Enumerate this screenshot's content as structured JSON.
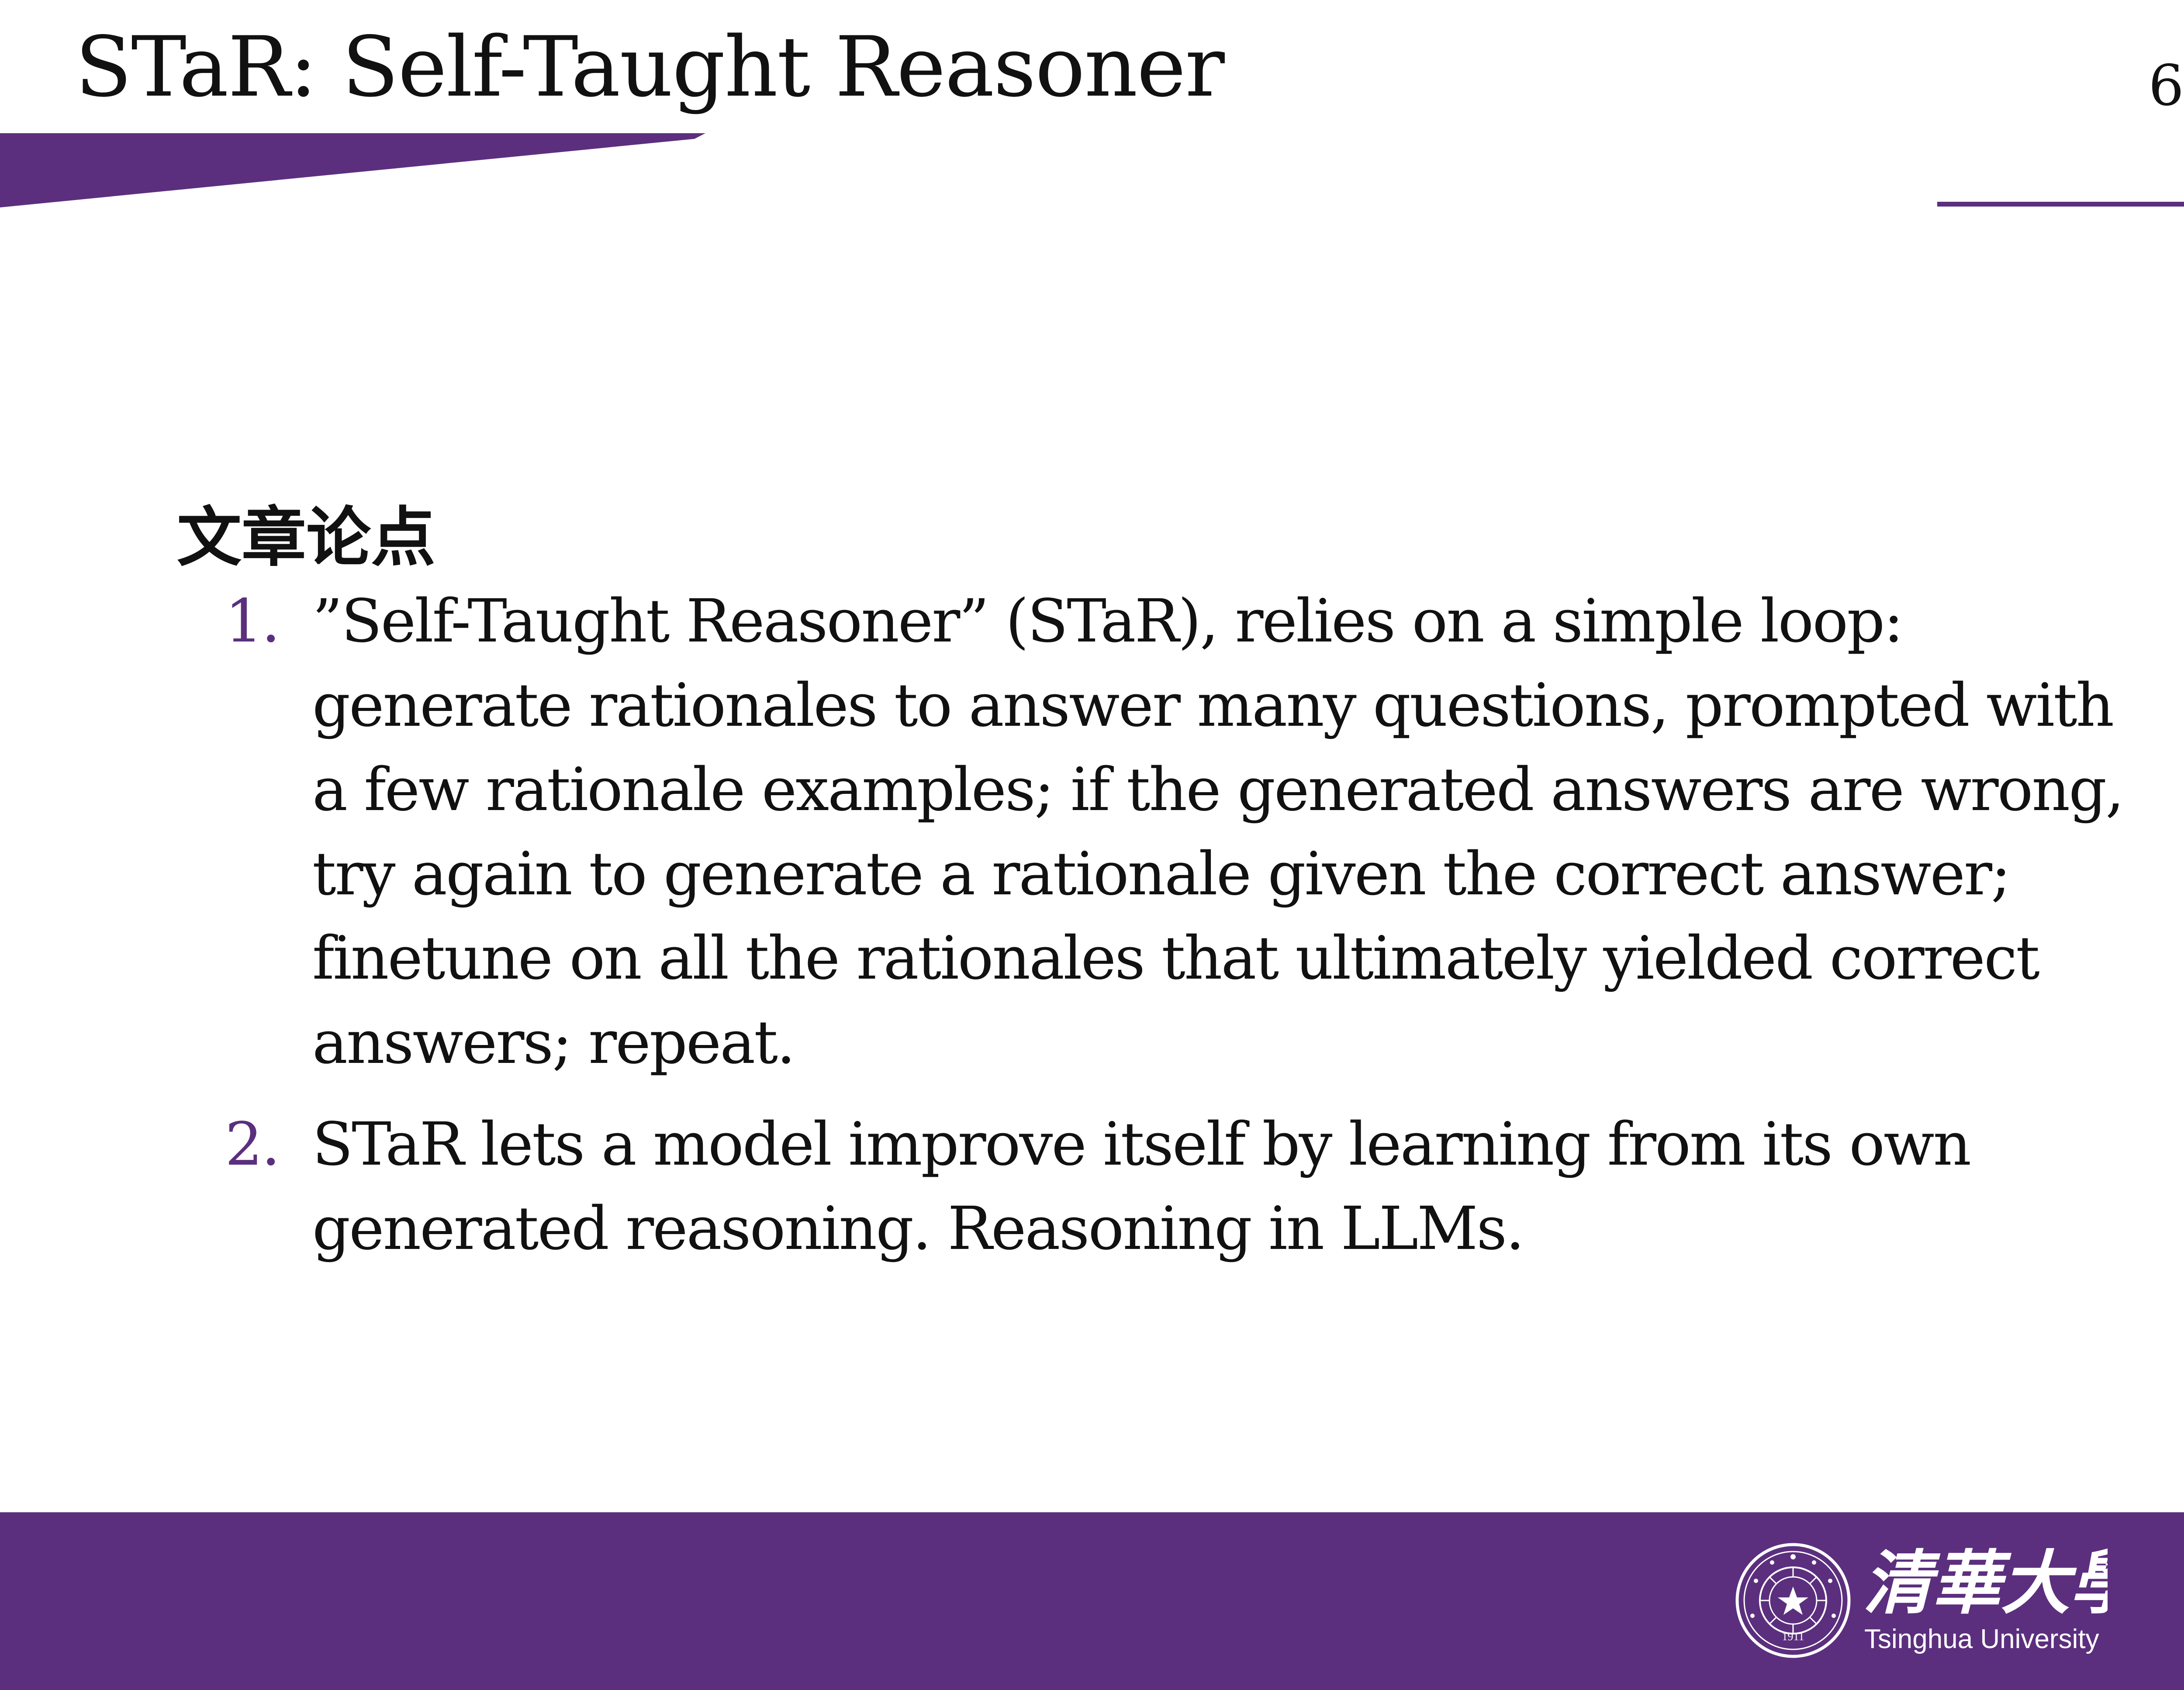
{
  "slide": {
    "title": "STaR: Self-Taught Reasoner",
    "page_number": "6"
  },
  "content": {
    "heading": "文章论点",
    "points": [
      {
        "number": "1.",
        "text": "”Self-Taught Reasoner” (STaR), relies on a simple loop: generate rationales to answer many questions, prompted with a few rationale examples; if the generated answers are wrong, try again to generate a rationale given the correct answer; finetune on all the rationales that ultimately yielded correct answers; repeat."
      },
      {
        "number": "2.",
        "text": "STaR lets a model improve itself by learning from its own generated reasoning. Reasoning in LLMs."
      }
    ]
  },
  "footer": {
    "logo_chinese": "清華大學",
    "logo_english": "Tsinghua University",
    "seal_year": "1911"
  },
  "colors": {
    "brand_purple": "#5b2f7e",
    "number_purple": "#5b2f7e",
    "text": "#111111",
    "logo_text": "#ffffff"
  },
  "icons": {
    "seal": "tsinghua-seal-icon"
  }
}
